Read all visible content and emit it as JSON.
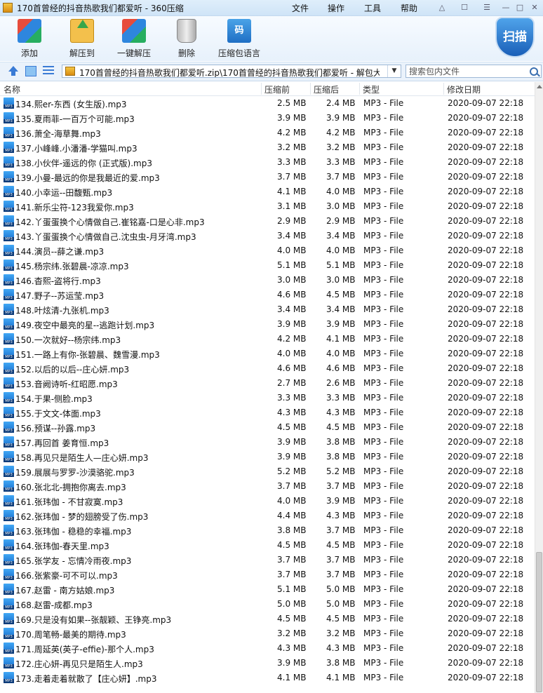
{
  "window": {
    "title": "170首曾经的抖音热歌我们都爱听 - 360压缩",
    "menu": [
      "文件",
      "操作",
      "工具",
      "帮助"
    ],
    "controls": [
      "shirt-icon",
      "feedback-icon",
      "menu-icon",
      "minimize-icon",
      "maximize-icon",
      "close-icon"
    ]
  },
  "toolbar": {
    "add": "添加",
    "extract": "解压到",
    "one_click_extract": "一键解压",
    "delete": "删除",
    "archive_language": "压缩包语言",
    "archive_language_glyph": "码",
    "scan": "扫描"
  },
  "address": {
    "path": "170首曾经的抖音热歌我们都爱听.zip\\170首曾经的抖音热歌我们都爱听 - 解包大",
    "search_placeholder": "搜索包内文件"
  },
  "columns": {
    "name": "名称",
    "size": "压缩前",
    "compressed": "压缩后",
    "type": "类型",
    "modified": "修改日期"
  },
  "files": [
    {
      "name": "134.熙er-东西 (女生版).mp3",
      "size": "2.5 MB",
      "compressed": "2.4 MB",
      "type": "MP3 - File",
      "modified": "2020-09-07 22:18"
    },
    {
      "name": "135.夏雨菲-一百万个可能.mp3",
      "size": "3.9 MB",
      "compressed": "3.9 MB",
      "type": "MP3 - File",
      "modified": "2020-09-07 22:18"
    },
    {
      "name": "136.萧全-海草舞.mp3",
      "size": "4.2 MB",
      "compressed": "4.2 MB",
      "type": "MP3 - File",
      "modified": "2020-09-07 22:18"
    },
    {
      "name": "137.小峰峰.小潘潘-学猫叫.mp3",
      "size": "3.2 MB",
      "compressed": "3.2 MB",
      "type": "MP3 - File",
      "modified": "2020-09-07 22:18"
    },
    {
      "name": "138.小伙伴-遥远的你 (正式版).mp3",
      "size": "3.3 MB",
      "compressed": "3.3 MB",
      "type": "MP3 - File",
      "modified": "2020-09-07 22:18"
    },
    {
      "name": "139.小曼-最远的你是我最近的爱.mp3",
      "size": "3.7 MB",
      "compressed": "3.7 MB",
      "type": "MP3 - File",
      "modified": "2020-09-07 22:18"
    },
    {
      "name": "140.小幸运--田馥甄.mp3",
      "size": "4.1 MB",
      "compressed": "4.0 MB",
      "type": "MP3 - File",
      "modified": "2020-09-07 22:18"
    },
    {
      "name": "141.新乐尘符-123我爱你.mp3",
      "size": "3.1 MB",
      "compressed": "3.0 MB",
      "type": "MP3 - File",
      "modified": "2020-09-07 22:18"
    },
    {
      "name": "142.丫蛋蛋换个心情做自己.崔铭嘉-口是心非.mp3",
      "size": "2.9 MB",
      "compressed": "2.9 MB",
      "type": "MP3 - File",
      "modified": "2020-09-07 22:18"
    },
    {
      "name": "143.丫蛋蛋换个心情做自己.沈虫虫-月牙湾.mp3",
      "size": "3.4 MB",
      "compressed": "3.4 MB",
      "type": "MP3 - File",
      "modified": "2020-09-07 22:18"
    },
    {
      "name": "144.演员--薛之谦.mp3",
      "size": "4.0 MB",
      "compressed": "4.0 MB",
      "type": "MP3 - File",
      "modified": "2020-09-07 22:18"
    },
    {
      "name": "145.杨宗纬.张碧晨-凉凉.mp3",
      "size": "5.1 MB",
      "compressed": "5.1 MB",
      "type": "MP3 - File",
      "modified": "2020-09-07 22:18"
    },
    {
      "name": "146.杳熙-盗将行.mp3",
      "size": "3.0 MB",
      "compressed": "3.0 MB",
      "type": "MP3 - File",
      "modified": "2020-09-07 22:18"
    },
    {
      "name": "147.野子--苏运莹.mp3",
      "size": "4.6 MB",
      "compressed": "4.5 MB",
      "type": "MP3 - File",
      "modified": "2020-09-07 22:18"
    },
    {
      "name": "148.叶炫清-九张机.mp3",
      "size": "3.4 MB",
      "compressed": "3.4 MB",
      "type": "MP3 - File",
      "modified": "2020-09-07 22:18"
    },
    {
      "name": "149.夜空中最亮的星--逃跑计划.mp3",
      "size": "3.9 MB",
      "compressed": "3.9 MB",
      "type": "MP3 - File",
      "modified": "2020-09-07 22:18"
    },
    {
      "name": "150.一次就好--杨宗纬.mp3",
      "size": "4.2 MB",
      "compressed": "4.1 MB",
      "type": "MP3 - File",
      "modified": "2020-09-07 22:18"
    },
    {
      "name": "151.一路上有你-张碧晨、魏雪漫.mp3",
      "size": "4.0 MB",
      "compressed": "4.0 MB",
      "type": "MP3 - File",
      "modified": "2020-09-07 22:18"
    },
    {
      "name": "152.以后的以后--庄心妍.mp3",
      "size": "4.6 MB",
      "compressed": "4.6 MB",
      "type": "MP3 - File",
      "modified": "2020-09-07 22:18"
    },
    {
      "name": "153.音阙诗听-红昭愿.mp3",
      "size": "2.7 MB",
      "compressed": "2.6 MB",
      "type": "MP3 - File",
      "modified": "2020-09-07 22:18"
    },
    {
      "name": "154.于果-侧脸.mp3",
      "size": "3.3 MB",
      "compressed": "3.3 MB",
      "type": "MP3 - File",
      "modified": "2020-09-07 22:18"
    },
    {
      "name": "155.于文文-体面.mp3",
      "size": "4.3 MB",
      "compressed": "4.3 MB",
      "type": "MP3 - File",
      "modified": "2020-09-07 22:18"
    },
    {
      "name": "156.预谋--孙露.mp3",
      "size": "4.5 MB",
      "compressed": "4.5 MB",
      "type": "MP3 - File",
      "modified": "2020-09-07 22:18"
    },
    {
      "name": "157.再回首 姜育恒.mp3",
      "size": "3.9 MB",
      "compressed": "3.8 MB",
      "type": "MP3 - File",
      "modified": "2020-09-07 22:18"
    },
    {
      "name": "158.再见只是陌生人—庄心妍.mp3",
      "size": "3.9 MB",
      "compressed": "3.8 MB",
      "type": "MP3 - File",
      "modified": "2020-09-07 22:18"
    },
    {
      "name": "159.展展与罗罗-沙漠骆驼.mp3",
      "size": "5.2 MB",
      "compressed": "5.2 MB",
      "type": "MP3 - File",
      "modified": "2020-09-07 22:18"
    },
    {
      "name": "160.张北北-拥抱你离去.mp3",
      "size": "3.7 MB",
      "compressed": "3.7 MB",
      "type": "MP3 - File",
      "modified": "2020-09-07 22:18"
    },
    {
      "name": "161.张玮伽 - 不甘寂寞.mp3",
      "size": "4.0 MB",
      "compressed": "3.9 MB",
      "type": "MP3 - File",
      "modified": "2020-09-07 22:18"
    },
    {
      "name": "162.张玮伽 - 梦的翅膀受了伤.mp3",
      "size": "4.4 MB",
      "compressed": "4.3 MB",
      "type": "MP3 - File",
      "modified": "2020-09-07 22:18"
    },
    {
      "name": "163.张玮伽 - 稳稳的幸福.mp3",
      "size": "3.8 MB",
      "compressed": "3.7 MB",
      "type": "MP3 - File",
      "modified": "2020-09-07 22:18"
    },
    {
      "name": "164.张玮伽-春天里.mp3",
      "size": "4.5 MB",
      "compressed": "4.5 MB",
      "type": "MP3 - File",
      "modified": "2020-09-07 22:18"
    },
    {
      "name": "165.张学友 - 忘情冷雨夜.mp3",
      "size": "3.7 MB",
      "compressed": "3.7 MB",
      "type": "MP3 - File",
      "modified": "2020-09-07 22:18"
    },
    {
      "name": "166.张紫豪-可不可以.mp3",
      "size": "3.7 MB",
      "compressed": "3.7 MB",
      "type": "MP3 - File",
      "modified": "2020-09-07 22:18"
    },
    {
      "name": "167.赵雷 - 南方姑娘.mp3",
      "size": "5.1 MB",
      "compressed": "5.0 MB",
      "type": "MP3 - File",
      "modified": "2020-09-07 22:18"
    },
    {
      "name": "168.赵雷-成都.mp3",
      "size": "5.0 MB",
      "compressed": "5.0 MB",
      "type": "MP3 - File",
      "modified": "2020-09-07 22:18"
    },
    {
      "name": "169.只是没有如果--张靓颖、王铮亮.mp3",
      "size": "4.5 MB",
      "compressed": "4.5 MB",
      "type": "MP3 - File",
      "modified": "2020-09-07 22:18"
    },
    {
      "name": "170.周笔畅-最美的期待.mp3",
      "size": "3.2 MB",
      "compressed": "3.2 MB",
      "type": "MP3 - File",
      "modified": "2020-09-07 22:18"
    },
    {
      "name": "171.周延英(英子-effie)-那个人.mp3",
      "size": "4.3 MB",
      "compressed": "4.3 MB",
      "type": "MP3 - File",
      "modified": "2020-09-07 22:18"
    },
    {
      "name": "172.庄心妍-再见只是陌生人.mp3",
      "size": "3.9 MB",
      "compressed": "3.8 MB",
      "type": "MP3 - File",
      "modified": "2020-09-07 22:18"
    },
    {
      "name": "173.走着走着就散了【庄心妍】.mp3",
      "size": "4.1 MB",
      "compressed": "4.1 MB",
      "type": "MP3 - File",
      "modified": "2020-09-07 22:18"
    }
  ],
  "file_icon_label": "MP3"
}
